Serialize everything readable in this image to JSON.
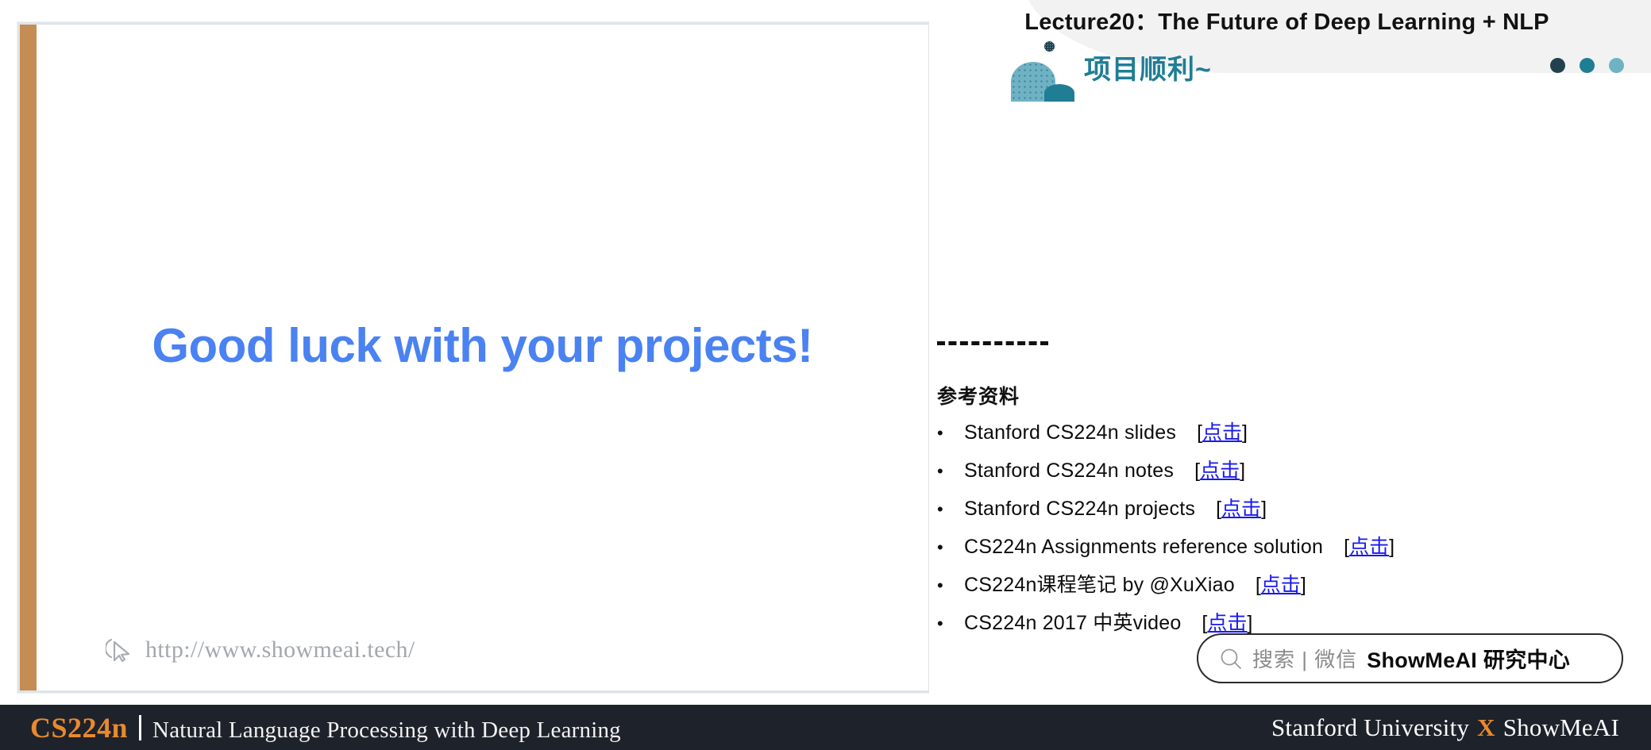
{
  "lecture": {
    "title": "Lecture20：The Future of Deep Learning + NLP"
  },
  "notes_panel": {
    "logo_heading": "项目顺利~",
    "logo_icon": "showmeai-logo-mark",
    "dots": [
      {
        "name": "dot-dark",
        "color": "#23404f"
      },
      {
        "name": "dot-teal",
        "color": "#1f7d94"
      },
      {
        "name": "dot-light-teal",
        "color": "#6fb2c4"
      }
    ],
    "divider": "- - - - - - - - - - - -",
    "references_heading": "参考资料",
    "references": [
      {
        "bullet": "•",
        "text": "Stanford CS224n slides",
        "link_open": "[",
        "link": "点击",
        "link_close": "]"
      },
      {
        "bullet": "•",
        "text": "Stanford CS224n notes",
        "link_open": "[",
        "link": "点击",
        "link_close": "]"
      },
      {
        "bullet": "•",
        "text": "Stanford CS224n projects",
        "link_open": "[",
        "link": "点击",
        "link_close": "]"
      },
      {
        "bullet": "•",
        "text": "CS224n Assignments reference solution",
        "link_open": "[",
        "link": "点击",
        "link_close": "]"
      },
      {
        "bullet": "•",
        "text": "CS224n课程笔记 by @XuXiao",
        "link_open": "[",
        "link": "点击",
        "link_close": "]"
      },
      {
        "bullet": "•",
        "text": "CS224n 2017 中英video",
        "link_open": "[",
        "link": "点击",
        "link_close": "]"
      }
    ]
  },
  "search": {
    "icon": "search-icon",
    "placeholder": "搜索 | 微信",
    "brand": "ShowMeAI 研究中心"
  },
  "slide": {
    "title": "Good luck with your projects!",
    "title_color": "#4a82f2",
    "accent_bar_color": "#c48d53",
    "watermark": {
      "icon": "cursor-icon",
      "url": "http://www.showmeai.tech/"
    }
  },
  "footer": {
    "course_code": "CS224n",
    "course_name": "Natural Language Processing with Deep Learning",
    "credit_left": "Stanford University",
    "credit_x": "X",
    "credit_right": "ShowMeAI",
    "accent_color": "#e88a2e",
    "background": "#1e222b"
  }
}
